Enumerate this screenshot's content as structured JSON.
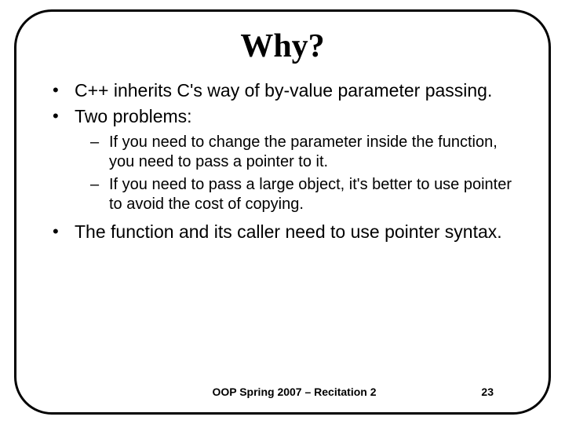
{
  "title": "Why?",
  "bullets": {
    "b1": "C++ inherits C's way of by-value parameter passing.",
    "b2": "Two problems:",
    "s1": "If you need to change the parameter inside the function, you need to pass a pointer to it.",
    "s2": "If you need to pass a large object, it's better to use pointer to avoid the cost of copying.",
    "b3": "The function and its caller need to use pointer syntax."
  },
  "footer": {
    "center": "OOP Spring 2007 – Recitation 2",
    "page": "23"
  }
}
